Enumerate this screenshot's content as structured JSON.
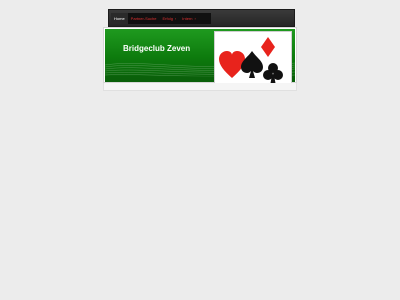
{
  "nav": {
    "items": [
      {
        "label": "Home",
        "active": true,
        "has_submenu": false
      },
      {
        "label": "Partner-Suche",
        "active": false,
        "has_submenu": false
      },
      {
        "label": "Erfolg",
        "active": false,
        "has_submenu": true
      },
      {
        "label": "Intern",
        "active": false,
        "has_submenu": true
      }
    ],
    "submenu_icon": "chevron-right-icon"
  },
  "header": {
    "title": "Bridgeclub Zeven",
    "emblem_icons": [
      "heart-icon",
      "spade-icon",
      "diamond-icon",
      "club-icon"
    ]
  },
  "colors": {
    "background": "#ececec",
    "banner_green": "#138a13",
    "nav_bg": "#262626",
    "nav_text": "#e03131",
    "heart": "#e8231c",
    "diamond": "#e8231c",
    "spade": "#111111",
    "club": "#111111"
  }
}
